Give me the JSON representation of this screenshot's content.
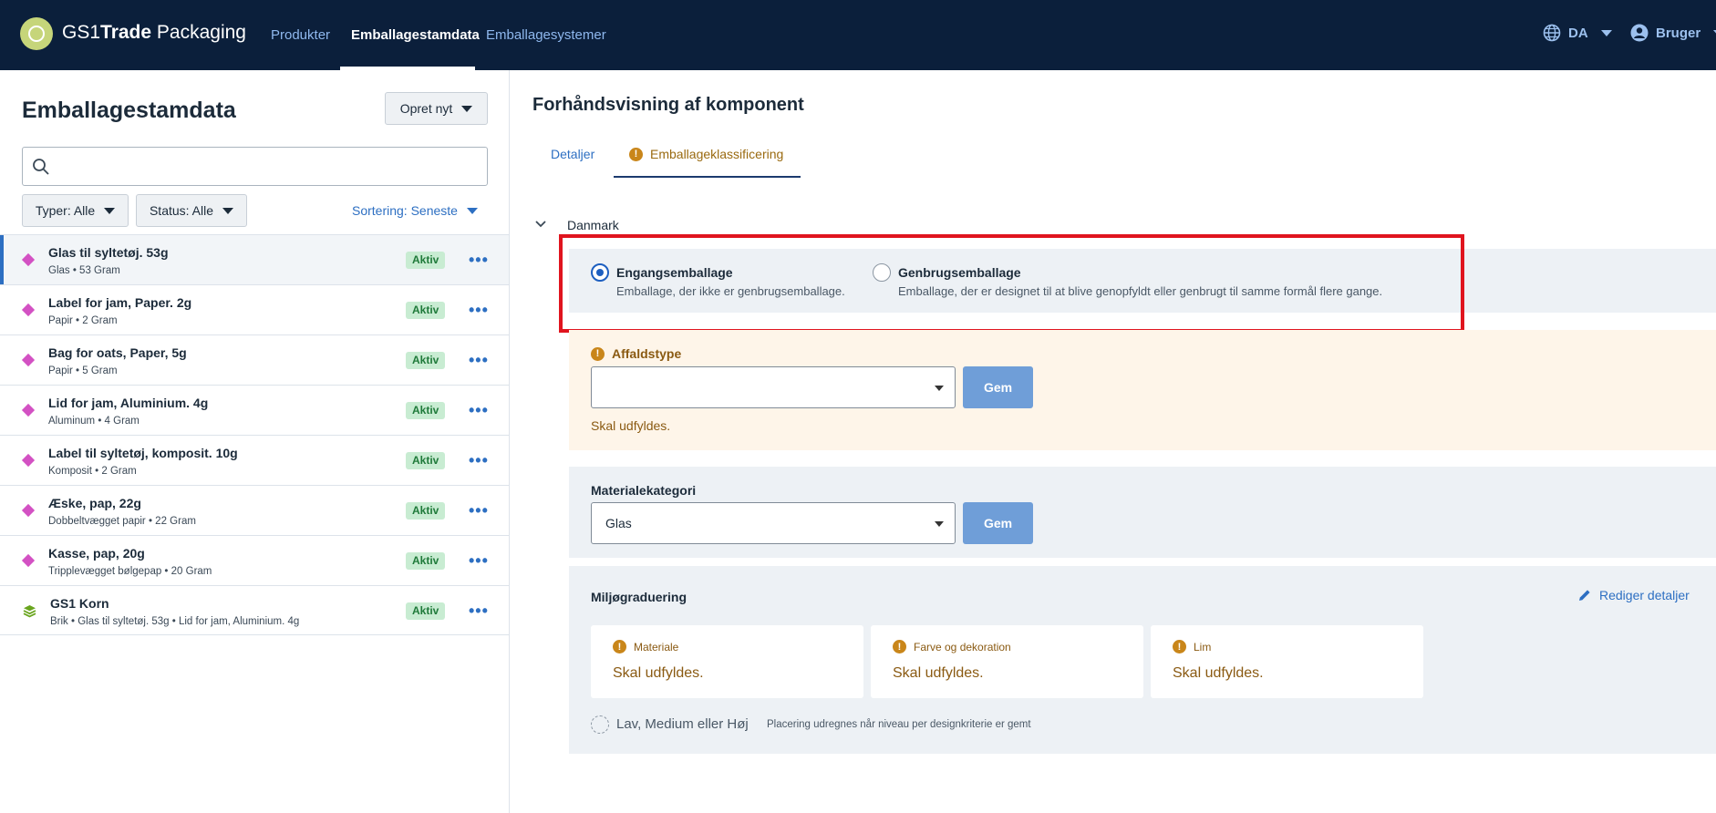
{
  "header": {
    "brand_prefix": "GS1",
    "brand_bold": "Trade",
    "brand_suffix": " Packaging",
    "nav": [
      {
        "label": "Produkter",
        "active": false
      },
      {
        "label": "Emballagestamdata",
        "active": true
      },
      {
        "label": "Emballagesystemer",
        "active": false
      }
    ],
    "language": "DA",
    "user": "Bruger"
  },
  "sidebar": {
    "title": "Emballagestamdata",
    "create_label": "Opret nyt",
    "search_value": "",
    "filter_type": "Typer: Alle",
    "filter_status": "Status: Alle",
    "sort_label": "Sortering: Seneste",
    "items": [
      {
        "title": "Glas til syltetøj. 53g",
        "sub": "Glas • 53 Gram",
        "status": "Aktiv",
        "icon": "diamond-icon"
      },
      {
        "title": "Label for jam, Paper. 2g",
        "sub": "Papir • 2 Gram",
        "status": "Aktiv",
        "icon": "diamond-icon"
      },
      {
        "title": "Bag for oats, Paper, 5g",
        "sub": "Papir • 5 Gram",
        "status": "Aktiv",
        "icon": "diamond-icon"
      },
      {
        "title": "Lid for jam, Aluminium. 4g",
        "sub": "Aluminum • 4 Gram",
        "status": "Aktiv",
        "icon": "diamond-icon"
      },
      {
        "title": "Label til syltetøj, komposit. 10g",
        "sub": "Komposit • 2 Gram",
        "status": "Aktiv",
        "icon": "diamond-icon"
      },
      {
        "title": "Æske, pap, 22g",
        "sub": "Dobbeltvægget papir • 22 Gram",
        "status": "Aktiv",
        "icon": "diamond-icon"
      },
      {
        "title": "Kasse, pap, 20g",
        "sub": "Tripplevægget bølgepap • 20 Gram",
        "status": "Aktiv",
        "icon": "diamond-icon"
      },
      {
        "title": "GS1 Korn",
        "sub": "Brik • Glas til syltetøj. 53g • Lid for jam, Aluminium. 4g",
        "status": "Aktiv",
        "icon": "layers-icon"
      }
    ]
  },
  "main": {
    "title": "Forhåndsvisning af komponent",
    "tabs": [
      {
        "label": "Detaljer"
      },
      {
        "label": "Emballageklassificering",
        "warning": true
      }
    ],
    "country": "Danmark",
    "packaging_options": [
      {
        "title": "Engangsemballage",
        "desc": "Emballage, der ikke er genbrugsemballage.",
        "selected": true
      },
      {
        "title": "Genbrugsemballage",
        "desc": "Emballage, der er designet til at blive genopfyldt eller genbrugt til samme formål flere gange.",
        "selected": false
      }
    ],
    "waste": {
      "label": "Affaldstype",
      "value": "",
      "save": "Gem",
      "error": "Skal udfyldes."
    },
    "material": {
      "label": "Materialekategori",
      "value": "Glas",
      "save": "Gem"
    },
    "environment": {
      "title": "Miljøgraduering",
      "edit_label": "Rediger detaljer",
      "cards": [
        {
          "label": "Materiale",
          "value": "Skal udfyldes."
        },
        {
          "label": "Farve og dekoration",
          "value": "Skal udfyldes."
        },
        {
          "label": "Lim",
          "value": "Skal udfyldes."
        }
      ],
      "level_text": "Lav, Medium eller Høj",
      "level_note": "Placering udregnes når niveau per designkriterie er gemt"
    }
  },
  "colors": {
    "header_bg": "#0b1f3b",
    "accent": "#2d6fc2",
    "highlight": "#e0141e",
    "warning": "#c9861a",
    "badge_bg": "#c8ecd2"
  }
}
